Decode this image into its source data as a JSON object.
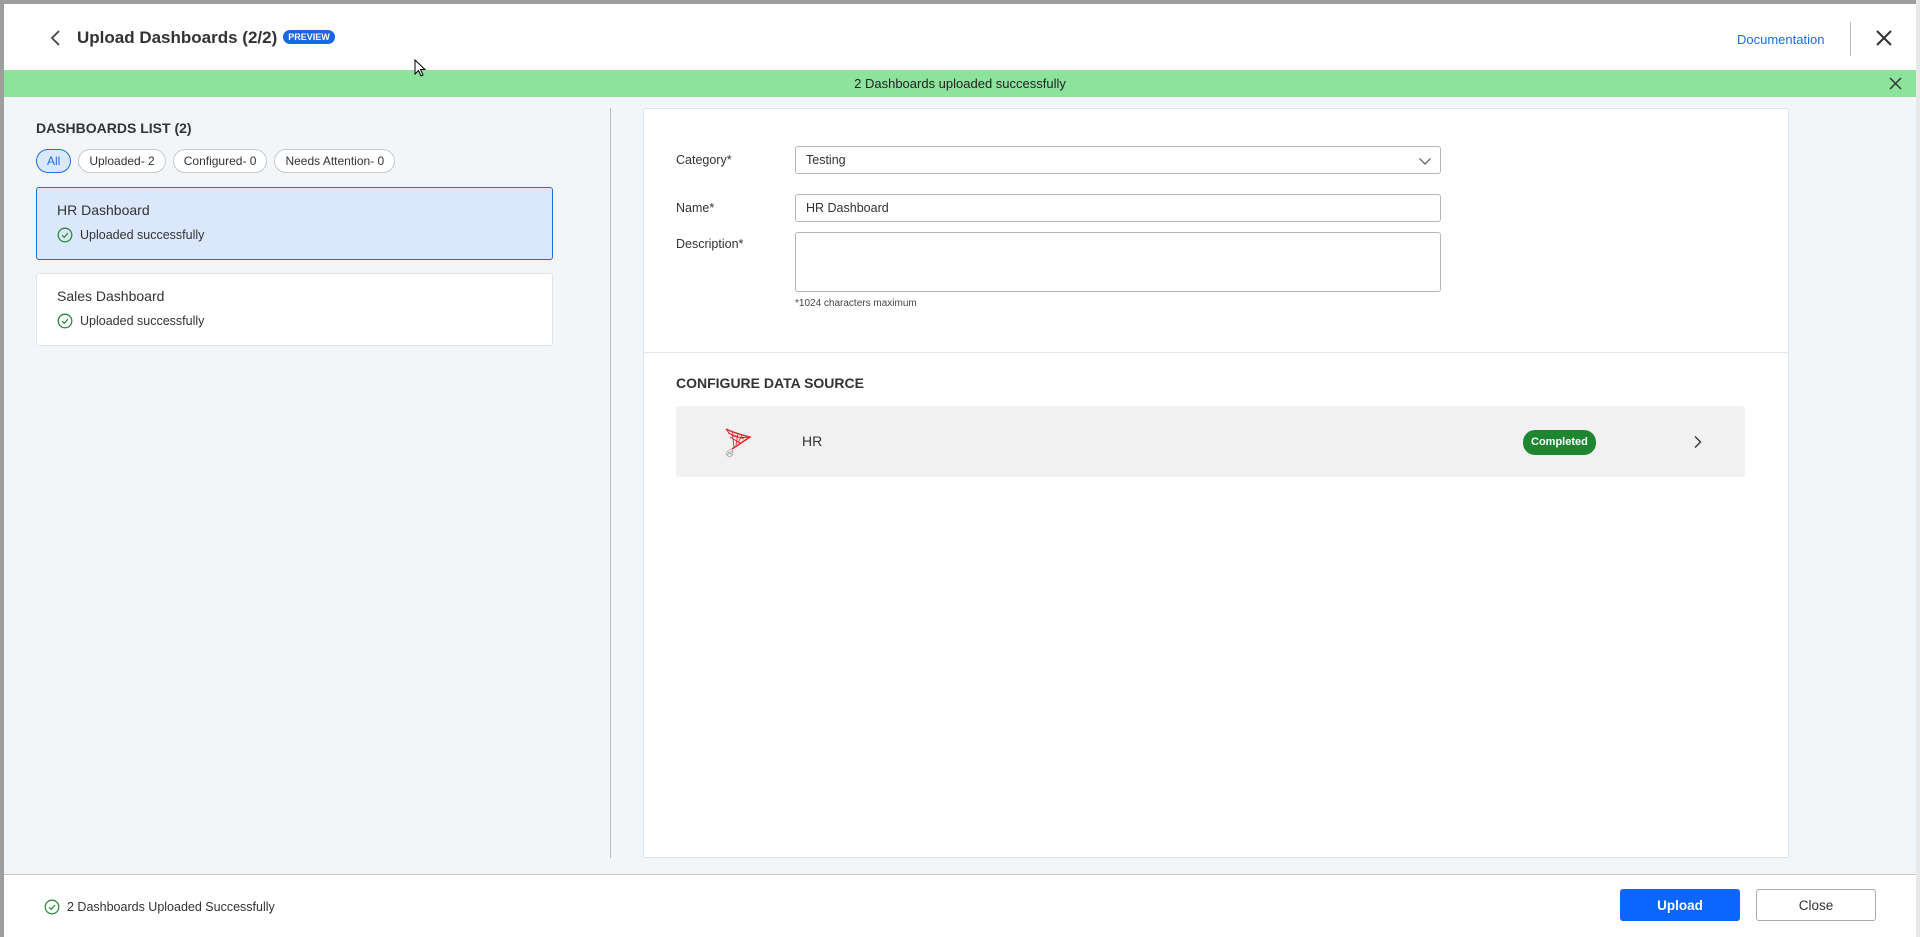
{
  "header": {
    "title": "Upload Dashboards (2/2)",
    "badge": "PREVIEW",
    "documentation_link": "Documentation"
  },
  "banner": {
    "message": "2 Dashboards uploaded successfully",
    "color": "#8de39c"
  },
  "dashboards_list": {
    "title": "DASHBOARDS LIST (2)",
    "filters": [
      {
        "label": "All",
        "active": true
      },
      {
        "label": "Uploaded- 2",
        "active": false
      },
      {
        "label": "Configured- 0",
        "active": false
      },
      {
        "label": "Needs Attention- 0",
        "active": false
      }
    ],
    "items": [
      {
        "name": "HR Dashboard",
        "status": "Uploaded successfully",
        "selected": true
      },
      {
        "name": "Sales Dashboard",
        "status": "Uploaded successfully",
        "selected": false
      }
    ]
  },
  "form": {
    "category_label": "Category*",
    "category_value": "Testing",
    "name_label": "Name*",
    "name_value": "HR Dashboard",
    "description_label": "Description*",
    "description_value": "",
    "description_hint": "*1024 characters maximum"
  },
  "data_source": {
    "section_title": "CONFIGURE DATA SOURCE",
    "items": [
      {
        "name": "HR",
        "icon": "sql-server-icon",
        "status": "Completed",
        "status_color": "#1e8531"
      }
    ]
  },
  "footer": {
    "status": "2 Dashboards Uploaded Successfully",
    "upload_label": "Upload",
    "close_label": "Close",
    "accent_color": "#0a66ff"
  }
}
